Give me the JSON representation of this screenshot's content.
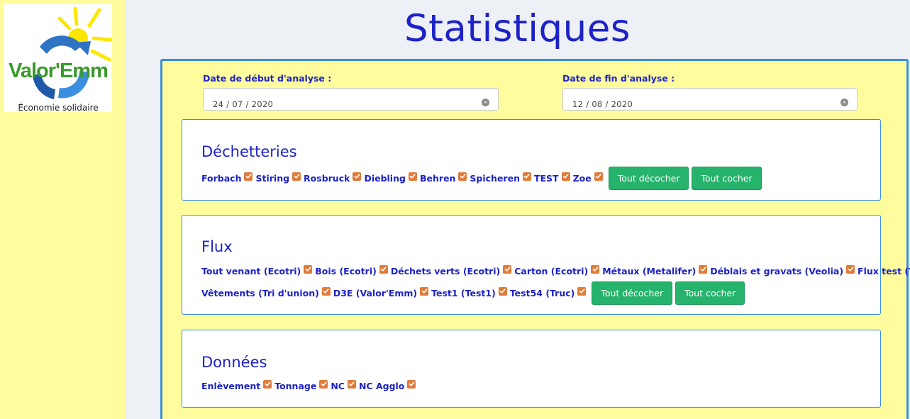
{
  "brand": {
    "name": "Valor'Emm",
    "tagline": "Économie solidaire"
  },
  "page": {
    "title": "Statistiques"
  },
  "dates": {
    "start_label": "Date de début d'analyse :",
    "start_value": "24 / 07 / 2020",
    "end_label": "Date de fin d'analyse :",
    "end_value": "12 / 08 / 2020"
  },
  "sections": {
    "decheteries": {
      "title": "Déchetteries",
      "items": [
        "Forbach",
        "Stiring",
        "Rosbruck",
        "Diebling",
        "Behren",
        "Spicheren",
        "TEST",
        "Zoe"
      ],
      "uncheck_all": "Tout décocher",
      "check_all": "Tout cocher"
    },
    "flux": {
      "title": "Flux",
      "items_row1": [
        "Tout venant (Ecotri)",
        "Bois (Ecotri)",
        "Déchets verts (Ecotri)",
        "Carton (Ecotri)",
        "Métaux (Metalifer)",
        "Déblais et gravats (Veolia)",
        "Flux test (Test)"
      ],
      "items_row2": [
        "Vêtements (Tri d'union)",
        "D3E (Valor'Emm)",
        "Test1 (Test1)",
        "Test54 (Truc)"
      ],
      "uncheck_all": "Tout décocher",
      "check_all": "Tout cocher"
    },
    "donnees": {
      "title": "Données",
      "items": [
        "Enlèvement",
        "Tonnage",
        "NC",
        "NC Agglo"
      ]
    }
  },
  "colors": {
    "sidebar_bg": "#fffc9e",
    "accent_blue": "#1d22c8",
    "panel_border": "#3c8fd6",
    "checkbox": "#e07b39",
    "button_green": "#26b36b"
  }
}
